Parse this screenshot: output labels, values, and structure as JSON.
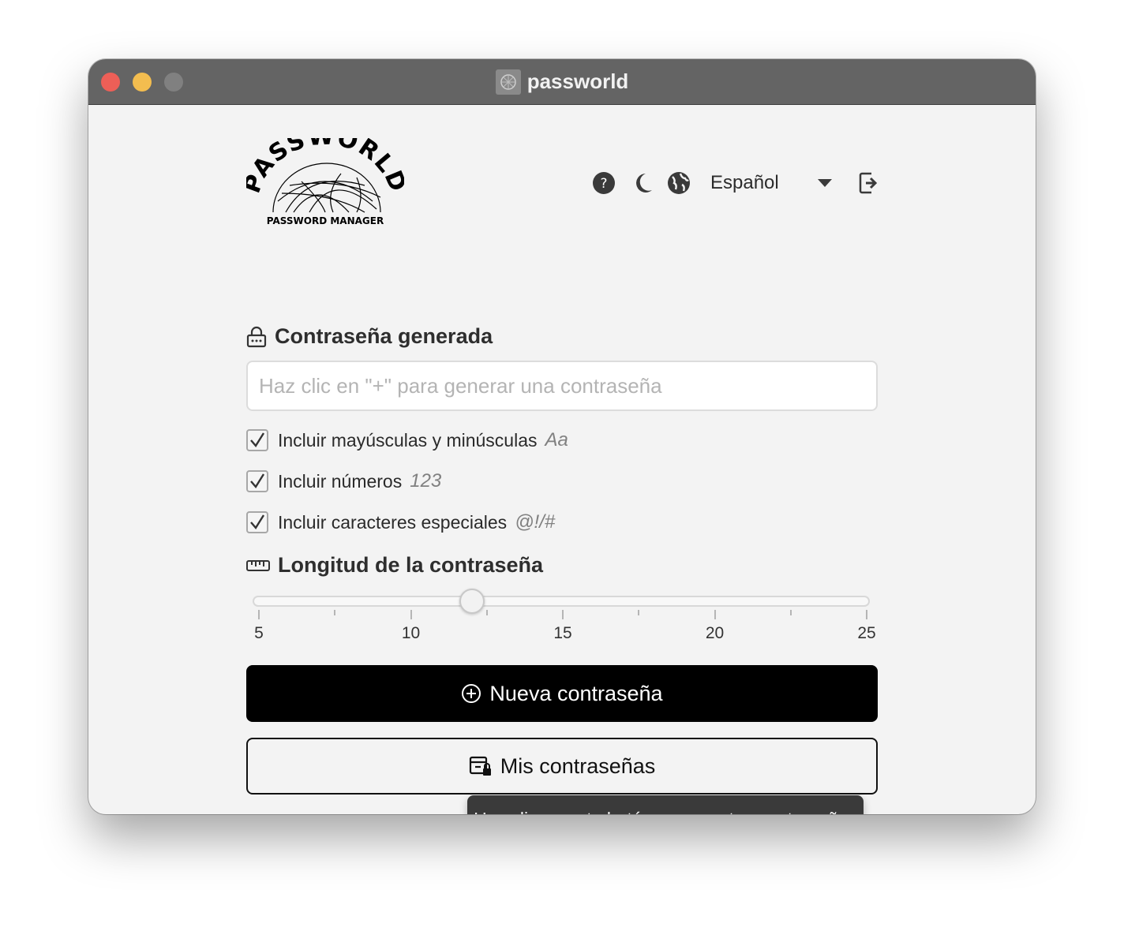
{
  "window": {
    "title": "passworld"
  },
  "logo": {
    "wordmark": "PASSWORLD",
    "subtitle": "PASSWORD MANAGER"
  },
  "header": {
    "icons": [
      "help-icon",
      "moon-icon",
      "globe-icon",
      "logout-icon"
    ],
    "language": {
      "selected": "Español"
    }
  },
  "generated": {
    "title": "Contraseña generada",
    "placeholder": "Haz clic en \"+\" para generar una contraseña",
    "value": ""
  },
  "options": [
    {
      "label": "Incluir mayúsculas y minúsculas",
      "hint": "Aa",
      "checked": true
    },
    {
      "label": "Incluir números",
      "hint": "123",
      "checked": true
    },
    {
      "label": "Incluir caracteres especiales",
      "hint": "@!/#",
      "checked": true
    }
  ],
  "length": {
    "title": "Longitud de la contraseña",
    "min": 5,
    "max": 25,
    "value": 12,
    "ticks": [
      "5",
      "10",
      "15",
      "20",
      "25"
    ]
  },
  "buttons": {
    "new_password": "Nueva contraseña",
    "my_passwords": "Mis contraseñas"
  },
  "tooltip": {
    "text": "Haz clic en este botón para ver tus contraseñas"
  },
  "colors": {
    "titlebar": "#646464",
    "close": "#ed5f57",
    "minimize": "#f3bd4f",
    "primary_button": "#000000"
  }
}
